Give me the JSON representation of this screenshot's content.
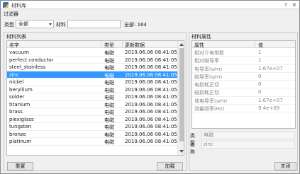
{
  "window": {
    "title": "材料库",
    "help_label": "?",
    "close_label": "×"
  },
  "filter": {
    "caption": "过滤器",
    "type_label": "类型",
    "type_value": "全部",
    "material_label": "材料",
    "material_value": "",
    "total_text": "全部: 164"
  },
  "material_list": {
    "caption": "材料列表",
    "columns": [
      "名字",
      "类型",
      "更新数据"
    ],
    "rows": [
      {
        "name": "vacuum",
        "type": "电磁",
        "date": "2019.06.06 08:41:05"
      },
      {
        "name": "perfect conductor",
        "type": "电磁",
        "date": "2019.06.06 08:41:05"
      },
      {
        "name": "steel_stainless",
        "type": "电磁",
        "date": "2019.06.06 08:41:05"
      },
      {
        "name": "zinc",
        "type": "电磁",
        "date": "2019.06.06 08:41:05"
      },
      {
        "name": "nickel",
        "type": "电磁",
        "date": "2019.06.06 08:41:05"
      },
      {
        "name": "beryllium",
        "type": "电磁",
        "date": "2019.06.06 08:41:05"
      },
      {
        "name": "solder",
        "type": "电磁",
        "date": "2019.06.06 08:41:05"
      },
      {
        "name": "titanium",
        "type": "电磁",
        "date": "2019.06.06 08:41:05"
      },
      {
        "name": "brass",
        "type": "电磁",
        "date": "2019.06.06 08:41:05"
      },
      {
        "name": "plexiglass",
        "type": "电磁",
        "date": "2019.06.06 08:41:05"
      },
      {
        "name": "tungsten",
        "type": "电磁",
        "date": "2019.06.06 08:41:05"
      },
      {
        "name": "bronze",
        "type": "电磁",
        "date": "2019.06.06 08:41:05"
      },
      {
        "name": "platinum",
        "type": "电磁",
        "date": "2019.06.06 08:41:05"
      }
    ],
    "selected_index": 3,
    "reset_label": "重置",
    "load_label": "加载"
  },
  "properties": {
    "caption": "材料属性",
    "columns": [
      "属性",
      "值"
    ],
    "rows": [
      {
        "name": "相对介电常数",
        "value": "1"
      },
      {
        "name": "相对磁导率",
        "value": "1"
      },
      {
        "name": "电导率(s/m)",
        "value": "1.67e+07"
      },
      {
        "name": "磁导率(s/m)",
        "value": "0"
      },
      {
        "name": "电损耗正切",
        "value": "0"
      },
      {
        "name": "磁损耗正切",
        "value": "0"
      },
      {
        "name": "体电导率(s/m)",
        "value": "1.67e+07"
      },
      {
        "name": "测量频率(Hz)",
        "value": "9.4e+09"
      }
    ],
    "type_label": "类型",
    "type_value": "电磁",
    "name_label": "名称",
    "name_value": "zinc",
    "close_label": "关闭"
  },
  "colors": {
    "selection": "#3399ff",
    "window_bg": "#f0f0f0"
  }
}
